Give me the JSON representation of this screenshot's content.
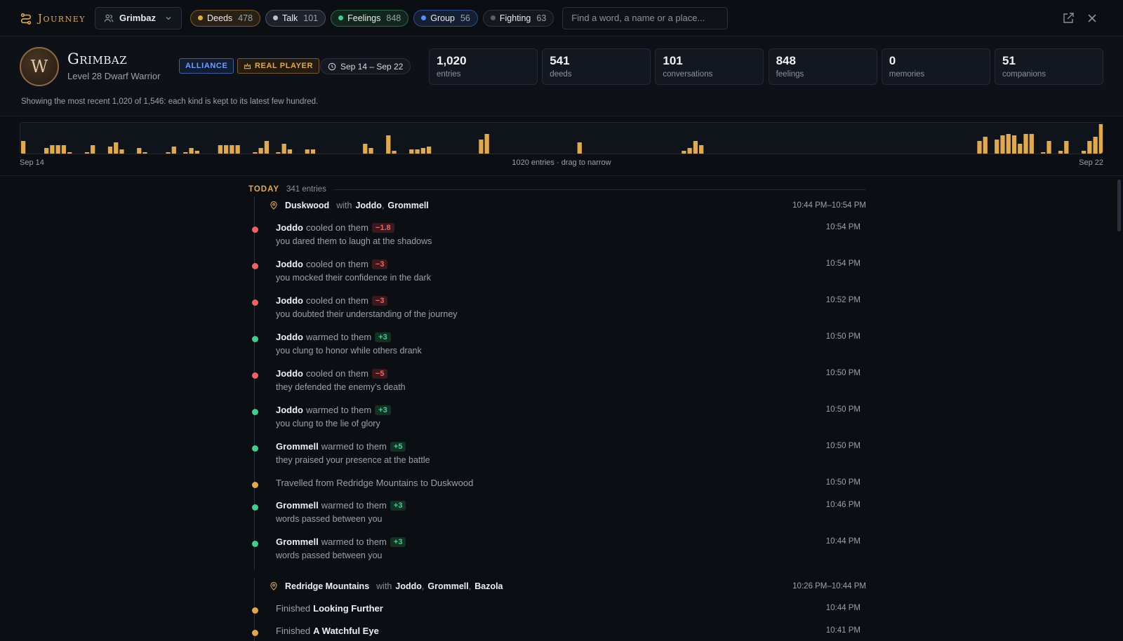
{
  "topbar": {
    "brand": "Journey",
    "character": "Grimbaz",
    "search_placeholder": "Find a word, a name or a place...",
    "filters": [
      {
        "label": "Deeds",
        "count": "478",
        "color": "#e2a94a",
        "border": "#7a5a2a",
        "bg": "#2a2116"
      },
      {
        "label": "Talk",
        "count": "101",
        "color": "#b9c0ca",
        "border": "#4a525e",
        "bg": "#1d222a"
      },
      {
        "label": "Feelings",
        "count": "848",
        "color": "#3ecf8e",
        "border": "#22694a",
        "bg": "#13261e"
      },
      {
        "label": "Group",
        "count": "56",
        "color": "#5b8def",
        "border": "#2e4f8f",
        "bg": "#151f33"
      },
      {
        "label": "Fighting",
        "count": "63",
        "color": "#5a606b",
        "border": "#2f353f",
        "bg": "#14181e"
      }
    ]
  },
  "header": {
    "avatar_letter": "W",
    "name": "Grimbaz",
    "subtitle": "Level 28 Dwarf Warrior",
    "faction": "ALLIANCE",
    "real_player": "REAL PLAYER",
    "date_range": "Sep 14 – Sep 22",
    "stats": [
      {
        "value": "1,020",
        "label": "entries"
      },
      {
        "value": "541",
        "label": "deeds"
      },
      {
        "value": "101",
        "label": "conversations"
      },
      {
        "value": "848",
        "label": "feelings"
      },
      {
        "value": "0",
        "label": "memories"
      },
      {
        "value": "51",
        "label": "companions"
      }
    ],
    "note": "Showing the most recent 1,020 of 1,546: each kind is kept to its latest few hundred."
  },
  "histogram": {
    "start_label": "Sep 14",
    "end_label": "Sep 22",
    "center_label": "1020 entries · drag to narrow",
    "color": "#e2a94a",
    "values": [
      20,
      0,
      0,
      0,
      10,
      14,
      14,
      14,
      4,
      0,
      0,
      4,
      14,
      0,
      0,
      12,
      18,
      8,
      0,
      0,
      10,
      4,
      0,
      0,
      0,
      4,
      12,
      0,
      4,
      10,
      6,
      0,
      0,
      0,
      14,
      14,
      14,
      14,
      0,
      0,
      4,
      10,
      20,
      0,
      4,
      16,
      8,
      0,
      0,
      8,
      8,
      0,
      0,
      0,
      0,
      0,
      0,
      0,
      0,
      16,
      10,
      0,
      0,
      28,
      6,
      0,
      0,
      8,
      8,
      10,
      12,
      0,
      0,
      0,
      0,
      0,
      0,
      0,
      0,
      22,
      30,
      0,
      0,
      0,
      0,
      0,
      0,
      0,
      0,
      0,
      0,
      0,
      0,
      0,
      0,
      0,
      18,
      0,
      0,
      0,
      0,
      0,
      0,
      0,
      0,
      0,
      0,
      0,
      0,
      0,
      0,
      0,
      0,
      0,
      6,
      10,
      20,
      14,
      0,
      0,
      0,
      0,
      0,
      0,
      0,
      0,
      0,
      0,
      0,
      0,
      0,
      0,
      0,
      0,
      0,
      0,
      0,
      0,
      0,
      0,
      0,
      0,
      0,
      0,
      0,
      0,
      0,
      0,
      0,
      0,
      0,
      0,
      0,
      0,
      0,
      0,
      0,
      0,
      0,
      0,
      0,
      0,
      0,
      0,
      0,
      20,
      26,
      0,
      22,
      28,
      30,
      28,
      16,
      30,
      30,
      0,
      4,
      20,
      0,
      6,
      20,
      0,
      0,
      6,
      20,
      26,
      44
    ]
  },
  "timeline": {
    "day_label": "TODAY",
    "day_count": "341 entries",
    "groups": [
      {
        "place": "Duskwood",
        "with_label": "with",
        "companions": [
          "Joddo",
          "Grommell"
        ],
        "range": "10:44 PM–10:54 PM",
        "events": [
          {
            "type": "feeling",
            "tone": "neg",
            "who": "Joddo",
            "verb": "cooled on them",
            "delta": "−1.8",
            "reason": "you dared them to laugh at the shadows",
            "time": "10:54 PM"
          },
          {
            "type": "feeling",
            "tone": "neg",
            "who": "Joddo",
            "verb": "cooled on them",
            "delta": "−3",
            "reason": "you mocked their confidence in the dark",
            "time": "10:54 PM"
          },
          {
            "type": "feeling",
            "tone": "neg",
            "who": "Joddo",
            "verb": "cooled on them",
            "delta": "−3",
            "reason": "you doubted their understanding of the journey",
            "time": "10:52 PM"
          },
          {
            "type": "feeling",
            "tone": "pos",
            "who": "Joddo",
            "verb": "warmed to them",
            "delta": "+3",
            "reason": "you clung to honor while others drank",
            "time": "10:50 PM"
          },
          {
            "type": "feeling",
            "tone": "neg",
            "who": "Joddo",
            "verb": "cooled on them",
            "delta": "−5",
            "reason": "they defended the enemy’s death",
            "time": "10:50 PM"
          },
          {
            "type": "feeling",
            "tone": "pos",
            "who": "Joddo",
            "verb": "warmed to them",
            "delta": "+3",
            "reason": "you clung to the lie of glory",
            "time": "10:50 PM"
          },
          {
            "type": "feeling",
            "tone": "pos",
            "who": "Grommell",
            "verb": "warmed to them",
            "delta": "+5",
            "reason": "they praised your presence at the battle",
            "time": "10:50 PM"
          },
          {
            "type": "deed",
            "tone": "deed",
            "text": "Travelled from Redridge Mountains to Duskwood",
            "time": "10:50 PM"
          },
          {
            "type": "feeling",
            "tone": "pos",
            "who": "Grommell",
            "verb": "warmed to them",
            "delta": "+3",
            "reason": "words passed between you",
            "time": "10:46 PM"
          },
          {
            "type": "feeling",
            "tone": "pos",
            "who": "Grommell",
            "verb": "warmed to them",
            "delta": "+3",
            "reason": "words passed between you",
            "time": "10:44 PM"
          }
        ]
      },
      {
        "place": "Redridge Mountains",
        "with_label": "with",
        "companions": [
          "Joddo",
          "Grommell",
          "Bazola"
        ],
        "range": "10:26 PM–10:44 PM",
        "events": [
          {
            "type": "quest",
            "tone": "deed",
            "prefix": "Finished",
            "quest": "Looking Further",
            "time": "10:44 PM"
          },
          {
            "type": "quest",
            "tone": "deed",
            "prefix": "Finished",
            "quest": "A Watchful Eye",
            "time": "10:41 PM"
          }
        ]
      }
    ]
  },
  "colors": {
    "accent": "#e2a94a",
    "positive": "#3ecf8e",
    "negative": "#f06262"
  }
}
